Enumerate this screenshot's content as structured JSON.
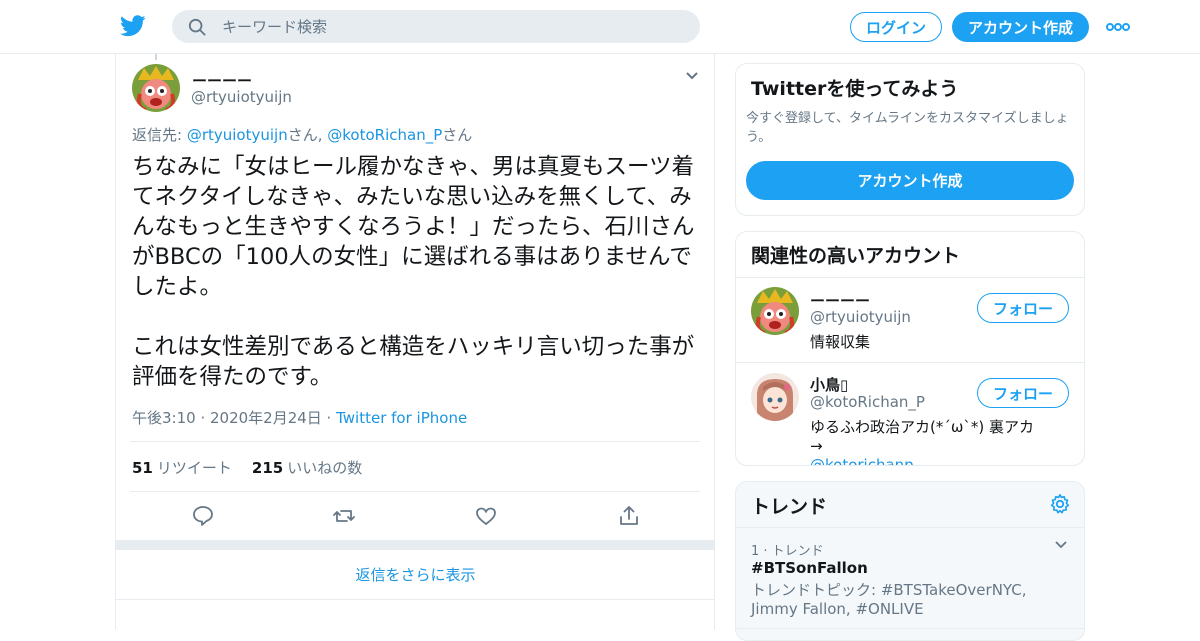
{
  "colors": {
    "accent": "#1da1f2",
    "link": "#1b95e0",
    "muted": "#657786",
    "border": "#e6ecf0"
  },
  "header": {
    "logo_icon": "twitter-bird-icon",
    "search_placeholder": "キーワード検索",
    "login_label": "ログイン",
    "signup_label": "アカウント作成",
    "more_icon": "more-dots-icon"
  },
  "tweet": {
    "author_name": "ーーーー",
    "author_handle": "@rtyuiotyuijn",
    "replying_prefix": "返信先: ",
    "reply_to_1": "@rtyuiotyuijn",
    "reply_mid": "さん, ",
    "reply_to_2": "@kotoRichan_P",
    "reply_suffix": "さん",
    "text": "ちなみに「女はヒール履かなきゃ、男は真夏もスーツ着てネクタイしなきゃ、みたいな思い込みを無くして、みんなもっと生きやすくなろうよ！」だったら、石川さんがBBCの「100人の女性」に選ばれる事はありませんでしたよ。\n\nこれは女性差別であると構造をハッキリ言い切った事が評価を得たのです。",
    "timestamp": "午後3:10 · 2020年2月24日 · ",
    "source": "Twitter for iPhone",
    "retweet_count": "51",
    "retweet_label": "リツイート",
    "like_count": "215",
    "like_label": "いいねの数",
    "more_replies_label": "返信をさらに表示"
  },
  "signup_card": {
    "title": "Twitterを使ってみよう",
    "description": "今すぐ登録して、タイムラインをカスタマイズしましょう。",
    "button_label": "アカウント作成"
  },
  "related": {
    "title": "関連性の高いアカウント",
    "accounts": [
      {
        "name": "ーーーー",
        "handle": "@rtyuiotyuijn",
        "bio": "情報収集",
        "bio_link": "",
        "follow_label": "フォロー"
      },
      {
        "name": "小鳥▯",
        "handle": "@kotoRichan_P",
        "bio": "ゆるふわ政治アカ(*´ω`*) 裏アカ→",
        "bio_link": "@kotorichanp",
        "follow_label": "フォロー"
      }
    ]
  },
  "trends": {
    "title": "トレンド",
    "items": [
      {
        "meta": "1 · トレンド",
        "name": "#BTSonFallon",
        "desc": "トレンドトピック: #BTSTakeOverNYC, Jimmy Fallon, #ONLIVE"
      }
    ]
  }
}
